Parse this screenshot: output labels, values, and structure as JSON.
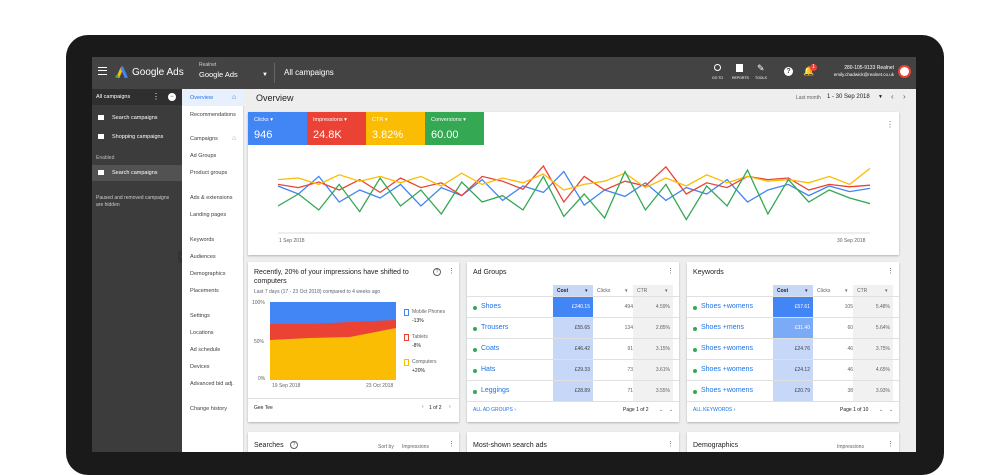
{
  "app": {
    "title": "Google Ads",
    "account_label": "Realnet",
    "account_name": "Google Ads",
    "page": "All campaigns"
  },
  "header": {
    "goto": "GO TO",
    "reports": "REPORTS",
    "tools": "TOOLS",
    "notif_count": "1",
    "phone": "280-105-9133 Realnet",
    "email": "emily.chadwick@realnet.co.uk"
  },
  "left": {
    "title": "All campaigns",
    "items": [
      "Search campaigns",
      "Shopping campaigns"
    ],
    "enabled_label": "Enabled",
    "enabled_item": "Search campaigns",
    "note_line1": "Paused and removed campaigns",
    "note_line2": "are hidden"
  },
  "nav": {
    "items": [
      "Overview",
      "Recommendations",
      "Campaigns",
      "Ad Groups",
      "Product groups",
      "Ads & extensions",
      "Landing pages",
      "Keywords",
      "Audiences",
      "Demographics",
      "Placements",
      "Settings",
      "Locations",
      "Ad schedule",
      "Devices",
      "Advanced bid adj.",
      "Change history"
    ]
  },
  "overview": {
    "title": "Overview",
    "date_label": "Last month",
    "date_range": "1 - 30 Sep 2018"
  },
  "metrics": [
    {
      "label": "Clicks",
      "value": "946",
      "color": "#4285f4"
    },
    {
      "label": "Impressions",
      "value": "24.8K",
      "color": "#ea4335"
    },
    {
      "label": "CTR",
      "value": "3.82%",
      "color": "#fbbc04"
    },
    {
      "label": "Conversions",
      "value": "60.00",
      "color": "#34a853"
    }
  ],
  "chart_data": {
    "type": "line",
    "x_start": "1 Sep 2018",
    "x_end": "30 Sep 2018",
    "series": [
      {
        "name": "Clicks",
        "color": "#4285f4",
        "values": [
          60,
          50,
          72,
          40,
          55,
          45,
          62,
          35,
          58,
          48,
          68,
          42,
          60,
          52,
          78,
          36,
          55,
          47,
          64,
          42,
          58,
          50,
          68,
          40,
          55,
          62,
          48,
          60,
          53,
          57
        ]
      },
      {
        "name": "Impressions",
        "color": "#ea4335",
        "values": [
          62,
          58,
          65,
          55,
          68,
          52,
          70,
          58,
          64,
          48,
          72,
          66,
          56,
          85,
          40,
          72,
          55,
          66,
          60,
          84,
          50,
          64,
          58,
          72,
          68,
          70,
          55,
          62,
          59,
          61
        ]
      },
      {
        "name": "CTR",
        "color": "#fbbc04",
        "values": [
          68,
          70,
          62,
          74,
          66,
          72,
          64,
          72,
          60,
          76,
          62,
          70,
          64,
          75,
          55,
          62,
          66,
          76,
          58,
          70,
          60,
          74,
          64,
          72,
          66,
          68,
          64,
          72,
          62,
          82
        ]
      },
      {
        "name": "Conversions",
        "color": "#34a853",
        "values": [
          35,
          50,
          30,
          62,
          28,
          70,
          35,
          55,
          25,
          65,
          40,
          48,
          30,
          72,
          22,
          50,
          20,
          78,
          30,
          62,
          18,
          60,
          35,
          80,
          25,
          68,
          40,
          55,
          45,
          38
        ]
      }
    ]
  },
  "device_card": {
    "title_line1": "Recently, 20% of your impressions have shifted to",
    "title_line2": "computers",
    "subtitle": "Last 7 days (17 - 23 Oct 2018) compared to 4 weeks ago",
    "legend": [
      {
        "label": "Mobile Phones",
        "change": "-13%",
        "color": "#4285f4"
      },
      {
        "label": "Tablets",
        "change": "-8%",
        "color": "#ea4335"
      },
      {
        "label": "Computers",
        "change": "+20%",
        "color": "#fbbc04"
      }
    ],
    "y_ticks": [
      "100%",
      "50%",
      "0%"
    ],
    "x_start": "19 Sep 2018",
    "x_end": "23 Oct 2018",
    "footer_left": "Gee Tee",
    "pager": "1 of 2"
  },
  "ad_groups": {
    "title": "Ad Groups",
    "col_cost": "Cost",
    "col_clicks": "Clicks",
    "col_ctr": "CTR",
    "rows": [
      {
        "name": "Shoes",
        "cost": "£240.15",
        "clicks": "494",
        "ctr": "4.59%"
      },
      {
        "name": "Trousers",
        "cost": "£55.65",
        "clicks": "134",
        "ctr": "2.85%"
      },
      {
        "name": "Coats",
        "cost": "£46.42",
        "clicks": "91",
        "ctr": "3.15%"
      },
      {
        "name": "Hats",
        "cost": "£29.33",
        "clicks": "73",
        "ctr": "3.61%"
      },
      {
        "name": "Leggings",
        "cost": "£28.89",
        "clicks": "71",
        "ctr": "3.55%"
      }
    ],
    "link": "ALL AD GROUPS",
    "pager": "Page 1 of 2"
  },
  "keywords": {
    "title": "Keywords",
    "col_cost": "Cost",
    "col_clicks": "Clicks",
    "col_ctr": "CTR",
    "rows": [
      {
        "name": "Shoes +womens",
        "cost": "£57.61",
        "clicks": "105",
        "ctr": "5.48%"
      },
      {
        "name": "Shoes +mens",
        "cost": "£31.40",
        "clicks": "60",
        "ctr": "5.64%"
      },
      {
        "name": "Shoes +womens",
        "cost": "£24.76",
        "clicks": "46",
        "ctr": "3.75%"
      },
      {
        "name": "Shoes +womens",
        "cost": "£24.12",
        "clicks": "46",
        "ctr": "4.65%"
      },
      {
        "name": "Shoes +womens",
        "cost": "£20.79",
        "clicks": "38",
        "ctr": "3.93%"
      }
    ],
    "link": "ALL KEYWORDS",
    "pager": "Page 1 of 10"
  },
  "bottom_cards": {
    "searches": "Searches",
    "sortby": "Sort by",
    "impressions": "Impressions",
    "shown_ads": "Most-shown search ads",
    "demographics": "Demographics"
  }
}
